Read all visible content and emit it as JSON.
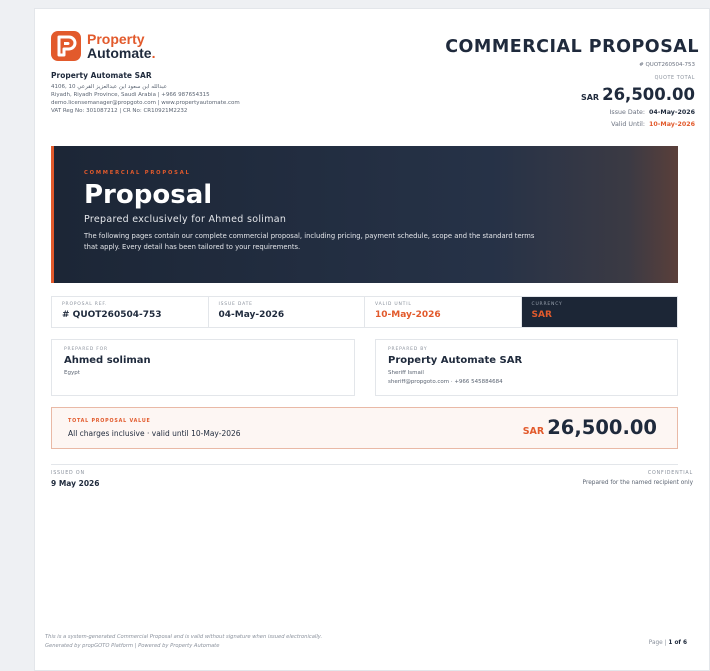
{
  "brand": {
    "name_line1": "Property",
    "name_line2": "Automate",
    "logo_icon": "property-automate-logo",
    "accent_color": "#e25a2c",
    "navy_color": "#1f2a3c"
  },
  "company": {
    "name": "Property Automate SAR",
    "address_line1": "4106, 10 عبدالله ابن سعود ابن عبدالعزيز القرعي",
    "address_line2": "Riyadh, Riyadh Province, Saudi Arabia | +966 987654315",
    "contact_line": "demo.licensemanager@propgoto.com | www.propertyautomate.com",
    "registration_line": "VAT Reg No: 301087212 | CR No: CR10921M2232"
  },
  "document": {
    "title": "COMMERCIAL PROPOSAL",
    "quote_ref": "# QUOT260504-753",
    "quote_total_label": "QUOTE TOTAL",
    "quote_total_currency": "SAR",
    "quote_total_amount": "26,500.00",
    "issue_date_label": "Issue Date:",
    "issue_date": "04-May-2026",
    "valid_until_label": "Valid Until:",
    "valid_until": "10-May-2026"
  },
  "hero": {
    "eyebrow": "COMMERCIAL PROPOSAL",
    "title": "Proposal",
    "subtitle": "Prepared exclusively for Ahmed soliman",
    "body": "The following pages contain our complete commercial proposal, including pricing, payment schedule, scope and the standard terms that apply. Every detail has been tailored to your requirements."
  },
  "info_strip": [
    {
      "label": "PROPOSAL REF.",
      "value": "# QUOT260504-753"
    },
    {
      "label": "ISSUE DATE",
      "value": "04-May-2026"
    },
    {
      "label": "VALID UNTIL",
      "value": "10-May-2026"
    },
    {
      "label": "CURRENCY",
      "value": "SAR"
    }
  ],
  "prepared_for": {
    "label": "PREPARED FOR",
    "name": "Ahmed soliman",
    "line1": "Egypt"
  },
  "prepared_by": {
    "label": "PREPARED BY",
    "name": "Property Automate SAR",
    "line1": "Sheriff Ismail",
    "line2": "sheriff@propgoto.com · +966 545884684"
  },
  "total": {
    "label": "TOTAL PROPOSAL VALUE",
    "note": "All charges inclusive · valid until 10-May-2026",
    "currency": "SAR",
    "amount": "26,500.00"
  },
  "issued": {
    "label": "ISSUED ON",
    "date": "9 May 2026"
  },
  "confidential": {
    "label": "CONFIDENTIAL",
    "note": "Prepared for the named recipient only"
  },
  "footer": {
    "line1": "This is a system-generated Commercial Proposal and is valid without signature when issued electronically.",
    "line2": "Generated by propGOTO Platform | Powered by Property Automate",
    "page_prefix": "Page |",
    "page_value": "1 of 6"
  }
}
